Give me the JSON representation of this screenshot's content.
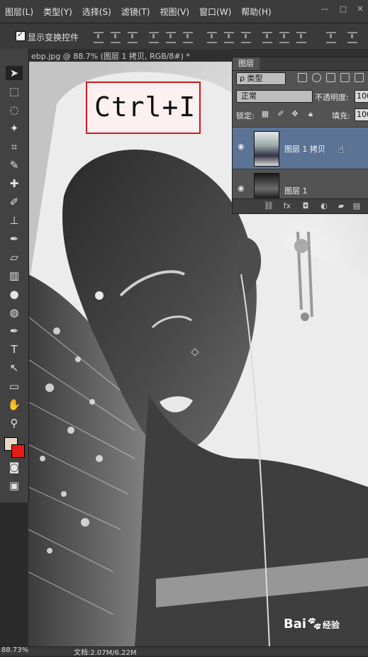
{
  "menubar": {
    "items": [
      "图层(L)",
      "类型(Y)",
      "选择(S)",
      "滤镜(T)",
      "视图(V)",
      "窗口(W)",
      "帮助(H)"
    ]
  },
  "options": {
    "show_transform_label": "显示变换控件",
    "show_transform_checked": true
  },
  "document": {
    "tab_title": "ebp.jpg @ 88.7% (图层 1 拷贝, RGB/8#) *"
  },
  "callout": {
    "text": "Ctrl+I"
  },
  "colors": {
    "foreground": "#e7d8c3",
    "background": "#e31c14",
    "selection": "#5b7394",
    "callout_border": "#d0181e"
  },
  "layers_panel": {
    "tab_label": "图层",
    "filter_label": "ρ 类型",
    "blend_mode": "正常",
    "opacity_label": "不透明度:",
    "opacity_value": "100",
    "lock_label": "锁定:",
    "fill_label": "填充:",
    "fill_value": "100",
    "layers": [
      {
        "name": "图层 1 拷贝",
        "selected": true,
        "visible": true
      },
      {
        "name": "图层 1",
        "selected": false,
        "visible": true
      }
    ]
  },
  "statusbar": {
    "zoom": "88.73%",
    "doc_info": "文档:2.07M/6.22M"
  },
  "watermark": {
    "brand": "Bai",
    "brand_tail": "经验"
  }
}
